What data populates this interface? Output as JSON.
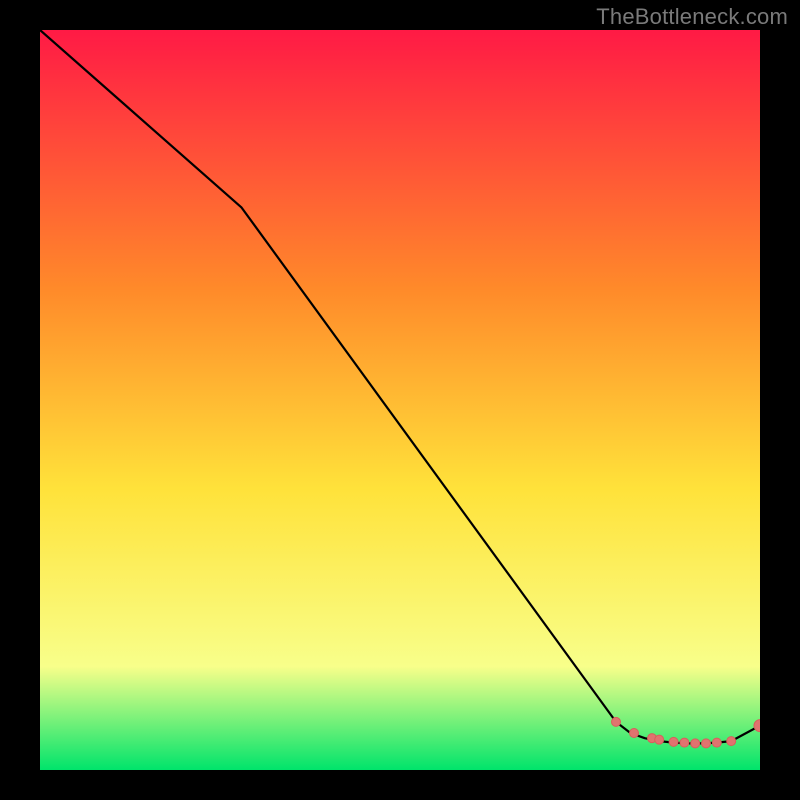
{
  "watermark": "TheBottleneck.com",
  "colors": {
    "background": "#000000",
    "line": "#000000",
    "marker_fill": "#e0736f",
    "marker_stroke": "#d85f5b",
    "gradient_top": "#ff1a45",
    "gradient_mid1": "#ff8a2a",
    "gradient_mid2": "#ffe23a",
    "gradient_mid3": "#f8ff8a",
    "gradient_bottom": "#00e46b"
  },
  "chart_data": {
    "type": "line",
    "title": "",
    "xlabel": "",
    "ylabel": "",
    "xlim": [
      0,
      100
    ],
    "ylim": [
      0,
      100
    ],
    "series": [
      {
        "name": "curve",
        "x": [
          0,
          28,
          80,
          82,
          84,
          86,
          88,
          90,
          92,
          94,
          96,
          100
        ],
        "y": [
          100,
          76,
          6.5,
          5.0,
          4.3,
          3.9,
          3.7,
          3.6,
          3.6,
          3.7,
          3.9,
          6.0
        ]
      }
    ],
    "highlight_points": {
      "x": [
        80,
        82.5,
        85,
        86,
        88,
        89.5,
        91,
        92.5,
        94,
        96,
        100
      ],
      "y": [
        6.5,
        5.0,
        4.3,
        4.1,
        3.8,
        3.7,
        3.6,
        3.6,
        3.7,
        3.9,
        6.0
      ]
    }
  }
}
